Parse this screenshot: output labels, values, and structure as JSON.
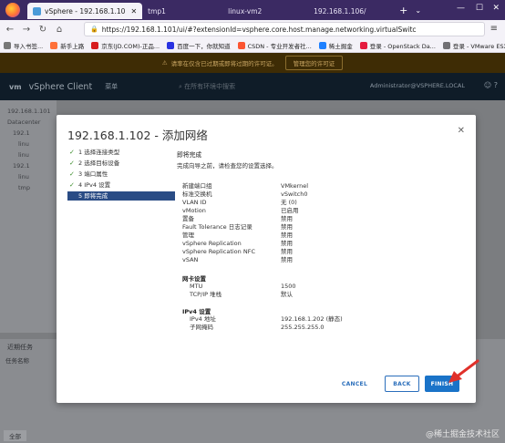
{
  "browser": {
    "tabs": [
      {
        "label": "vSphere - 192.168.1.10",
        "active": true
      },
      {
        "label": "tmp1",
        "active": false
      },
      {
        "label": "linux-vm2",
        "active": false
      },
      {
        "label": "192.168.1.106/",
        "active": false
      }
    ],
    "url": "https://192.168.1.101/ui/#?extensionId=vsphere.core.host.manage.networking.virtualSwitc",
    "bookmarks": [
      "导入书签...",
      "新手上路",
      "京东(JD.COM)-正品...",
      "百度一下，你就知道",
      "CSDN - 专业开发者社...",
      "稀土掘金",
      "登录 - OpenStack Da...",
      "登录 - VMware ESXi"
    ]
  },
  "vsphere": {
    "warning_text": "请率在仅含已过期或即将过期的许可证。",
    "warning_button": "管理您的许可证",
    "logo": "vm",
    "title": "vSphere Client",
    "menu": "菜单",
    "search_placeholder": "在所有环境中搜索",
    "user": "Administrator@VSPHERE.LOCAL",
    "tree": [
      "192.168.1.101",
      "Datacenter",
      "192.1",
      "linu",
      "linu",
      "192.1",
      "linu",
      "tmp"
    ],
    "recent_tasks": "近期任务",
    "recent_col": "任务名称",
    "footer_all": "全部",
    "watermark": "@稀土掘金技术社区"
  },
  "modal": {
    "title": "192.168.1.102 - 添加网络",
    "steps": [
      {
        "num": "1",
        "label": "选择连接类型",
        "done": true
      },
      {
        "num": "2",
        "label": "选择目标设备",
        "done": true
      },
      {
        "num": "3",
        "label": "端口属性",
        "done": true
      },
      {
        "num": "4",
        "label": "IPv4 设置",
        "done": true
      },
      {
        "num": "5",
        "label": "即将完成",
        "done": false
      }
    ],
    "heading": "即将完成",
    "description": "完成向导之前，请检查您的设置选择。",
    "summary": [
      {
        "k": "新建端口组",
        "v": "VMkernel"
      },
      {
        "k": "标准交换机",
        "v": "vSwitch0"
      },
      {
        "k": "VLAN ID",
        "v": "无 (0)"
      },
      {
        "k": "vMotion",
        "v": "已启用"
      },
      {
        "k": "置备",
        "v": "禁用"
      },
      {
        "k": "Fault Tolerance 日志记录",
        "v": "禁用"
      },
      {
        "k": "管理",
        "v": "禁用"
      },
      {
        "k": "vSphere Replication",
        "v": "禁用"
      },
      {
        "k": "vSphere Replication NFC",
        "v": "禁用"
      },
      {
        "k": "vSAN",
        "v": "禁用"
      }
    ],
    "nic_title": "网卡设置",
    "nic": [
      {
        "k": "MTU",
        "v": "1500"
      },
      {
        "k": "TCP/IP 堆栈",
        "v": "默认"
      }
    ],
    "ipv4_title": "IPv4 设置",
    "ipv4": [
      {
        "k": "IPv4 地址",
        "v": "192.168.1.202 (静态)"
      },
      {
        "k": "子网掩码",
        "v": "255.255.255.0"
      }
    ],
    "cancel": "CANCEL",
    "back": "BACK",
    "finish": "FINISH"
  }
}
